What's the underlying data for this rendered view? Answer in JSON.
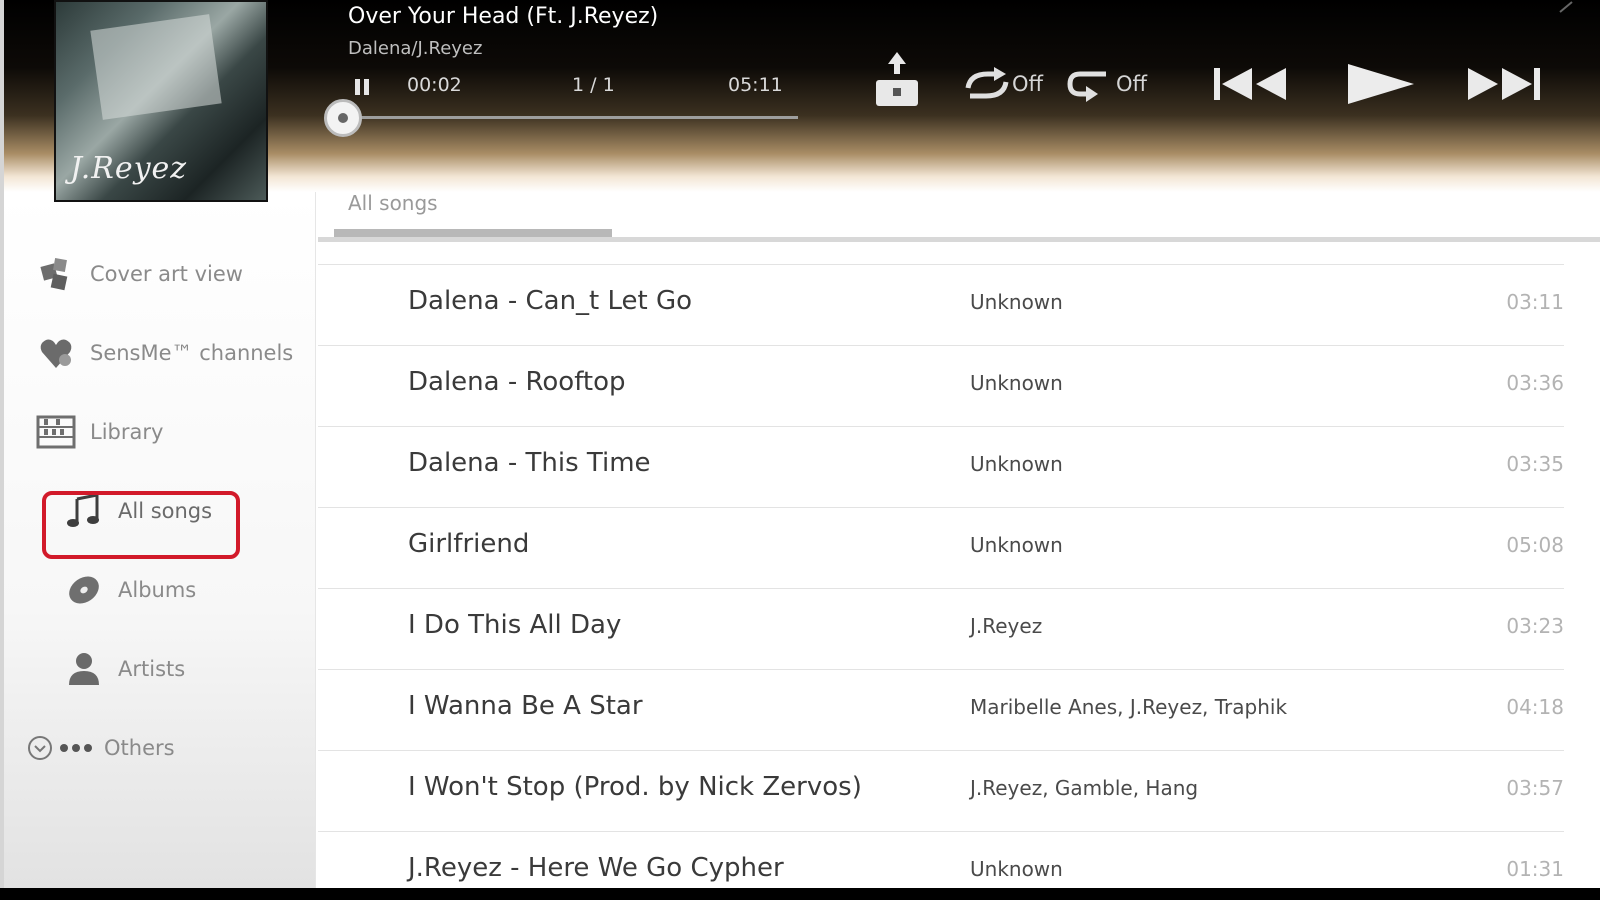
{
  "player": {
    "song_title": "Over Your Head (Ft. J.Reyez)",
    "song_artist": "Dalena/J.Reyez",
    "elapsed": "00:02",
    "track_count": "1 / 1",
    "duration": "05:11",
    "progress_fraction": 0.006,
    "shuffle_state": "Off",
    "repeat_state": "Off",
    "cover_text": "J.Reyez"
  },
  "sidebar": {
    "items": [
      {
        "label": "Cover art view",
        "icon": "cover-art-icon"
      },
      {
        "label": "SensMe™ channels",
        "icon": "sensme-heart-icon"
      },
      {
        "label": "Library",
        "icon": "library-icon"
      },
      {
        "label": "All songs",
        "icon": "music-note-icon"
      },
      {
        "label": "Albums",
        "icon": "album-disc-icon"
      },
      {
        "label": "Artists",
        "icon": "person-icon"
      },
      {
        "label": "Others",
        "icon": "more-dots-icon"
      }
    ]
  },
  "tabs": {
    "active": "All songs"
  },
  "songs": [
    {
      "title": "Dalena - Can_t Let Go",
      "artist": "Unknown",
      "time": "03:11"
    },
    {
      "title": "Dalena - Rooftop",
      "artist": "Unknown",
      "time": "03:36"
    },
    {
      "title": "Dalena - This Time",
      "artist": "Unknown",
      "time": "03:35"
    },
    {
      "title": "Girlfriend",
      "artist": "Unknown",
      "time": "05:08"
    },
    {
      "title": "I Do This All Day",
      "artist": "J.Reyez",
      "time": "03:23"
    },
    {
      "title": "I Wanna Be A Star",
      "artist": "Maribelle Anes, J.Reyez, Traphik",
      "time": "04:18"
    },
    {
      "title": "I Won't Stop (Prod. by Nick Zervos)",
      "artist": "J.Reyez, Gamble, Hang",
      "time": "03:57"
    },
    {
      "title": "J.Reyez - Here We Go Cypher",
      "artist": "Unknown",
      "time": "01:31"
    }
  ],
  "colors": {
    "highlight": "#d21a2a",
    "header_dark": "#000000",
    "text_primary": "#3a3a3a",
    "text_muted": "#8a8a8a"
  }
}
